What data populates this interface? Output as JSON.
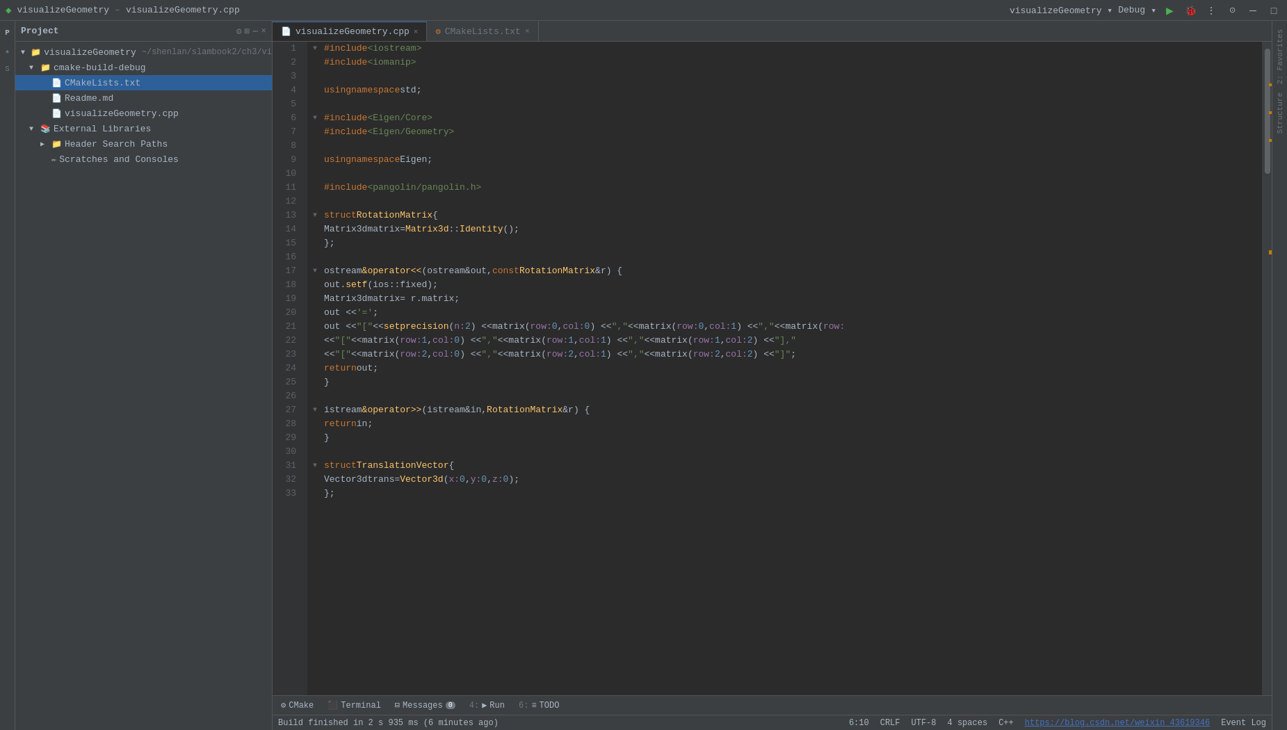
{
  "titlebar": {
    "project_name": "visualizeGeometry",
    "file_name": "visualizeGeometry.cpp",
    "config": "Debug",
    "run_label": "▶",
    "debug_label": "🐞"
  },
  "tabs": [
    {
      "id": "tab-cpp",
      "label": "visualizeGeometry.cpp",
      "icon": "📄",
      "active": true
    },
    {
      "id": "tab-cmake",
      "label": "CMakeLists.txt",
      "icon": "⚙",
      "active": false
    }
  ],
  "project_panel": {
    "title": "Project",
    "tree": [
      {
        "indent": 0,
        "arrow": "▼",
        "icon": "📁",
        "label": "visualizeGeometry",
        "extra": "~/shenlan/slambook2/ch3/vi",
        "selected": false
      },
      {
        "indent": 1,
        "arrow": "▼",
        "icon": "📁",
        "label": "cmake-build-debug",
        "selected": false
      },
      {
        "indent": 2,
        "arrow": "",
        "icon": "📄",
        "label": "CMakeLists.txt",
        "selected": true
      },
      {
        "indent": 2,
        "arrow": "",
        "icon": "📄",
        "label": "Readme.md",
        "selected": false
      },
      {
        "indent": 2,
        "arrow": "",
        "icon": "📄",
        "label": "visualizeGeometry.cpp",
        "selected": false
      },
      {
        "indent": 1,
        "arrow": "▼",
        "icon": "📚",
        "label": "External Libraries",
        "selected": false
      },
      {
        "indent": 2,
        "arrow": "▶",
        "icon": "📁",
        "label": "Header Search Paths",
        "selected": false
      },
      {
        "indent": 2,
        "arrow": "",
        "icon": "✏",
        "label": "Scratches and Consoles",
        "selected": false
      }
    ]
  },
  "code_lines": [
    {
      "num": 1,
      "fold": true,
      "tokens": [
        {
          "t": "#include ",
          "c": "inc"
        },
        {
          "t": "<iostream>",
          "c": "hdr"
        }
      ]
    },
    {
      "num": 2,
      "fold": false,
      "tokens": [
        {
          "t": "#include ",
          "c": "inc"
        },
        {
          "t": "<iomanip>",
          "c": "hdr"
        }
      ]
    },
    {
      "num": 3,
      "fold": false,
      "tokens": []
    },
    {
      "num": 4,
      "fold": false,
      "tokens": [
        {
          "t": "using ",
          "c": "kw"
        },
        {
          "t": "namespace ",
          "c": "kw"
        },
        {
          "t": "std;",
          "c": "plain"
        }
      ]
    },
    {
      "num": 5,
      "fold": false,
      "tokens": []
    },
    {
      "num": 6,
      "fold": true,
      "tokens": [
        {
          "t": "#include ",
          "c": "inc"
        },
        {
          "t": "<Eigen/Core>",
          "c": "hdr"
        }
      ]
    },
    {
      "num": 7,
      "fold": false,
      "tokens": [
        {
          "t": "#include ",
          "c": "inc"
        },
        {
          "t": "<Eigen/Geometry>",
          "c": "hdr"
        }
      ]
    },
    {
      "num": 8,
      "fold": false,
      "tokens": []
    },
    {
      "num": 9,
      "fold": false,
      "tokens": [
        {
          "t": "using ",
          "c": "kw"
        },
        {
          "t": "namespace ",
          "c": "kw"
        },
        {
          "t": "Eigen;",
          "c": "plain"
        }
      ]
    },
    {
      "num": 10,
      "fold": false,
      "tokens": []
    },
    {
      "num": 11,
      "fold": false,
      "tokens": [
        {
          "t": "#include ",
          "c": "inc"
        },
        {
          "t": "<pangolin/pangolin.h>",
          "c": "hdr"
        }
      ]
    },
    {
      "num": 12,
      "fold": false,
      "tokens": []
    },
    {
      "num": 13,
      "fold": true,
      "tokens": [
        {
          "t": "struct ",
          "c": "kw"
        },
        {
          "t": "RotationMatrix ",
          "c": "cls"
        },
        {
          "t": "{",
          "c": "plain"
        }
      ]
    },
    {
      "num": 14,
      "fold": false,
      "tokens": [
        {
          "t": "    Matrix3d ",
          "c": "plain"
        },
        {
          "t": "matrix",
          "c": "plain"
        },
        {
          "t": " = ",
          "c": "plain"
        },
        {
          "t": "Matrix3d",
          "c": "cls"
        },
        {
          "t": "::",
          "c": "plain"
        },
        {
          "t": "Identity",
          "c": "fn"
        },
        {
          "t": "();",
          "c": "plain"
        }
      ]
    },
    {
      "num": 15,
      "fold": false,
      "tokens": [
        {
          "t": "};",
          "c": "plain"
        }
      ]
    },
    {
      "num": 16,
      "fold": false,
      "tokens": []
    },
    {
      "num": 17,
      "fold": true,
      "tokens": [
        {
          "t": "ostream ",
          "c": "plain"
        },
        {
          "t": "&operator<<",
          "c": "fn"
        },
        {
          "t": "(",
          "c": "plain"
        },
        {
          "t": "ostream ",
          "c": "plain"
        },
        {
          "t": "&out, ",
          "c": "plain"
        },
        {
          "t": "const ",
          "c": "kw"
        },
        {
          "t": "RotationMatrix ",
          "c": "cls"
        },
        {
          "t": "&r) {",
          "c": "plain"
        }
      ]
    },
    {
      "num": 18,
      "fold": false,
      "tokens": [
        {
          "t": "    out.",
          "c": "plain"
        },
        {
          "t": "setf",
          "c": "fn"
        },
        {
          "t": "(",
          "c": "plain"
        },
        {
          "t": "ios::fixed",
          "c": "plain"
        },
        {
          "t": ");",
          "c": "plain"
        }
      ]
    },
    {
      "num": 19,
      "fold": false,
      "tokens": [
        {
          "t": "    Matrix3d ",
          "c": "plain"
        },
        {
          "t": "matrix",
          "c": "plain"
        },
        {
          "t": " = r.",
          "c": "plain"
        },
        {
          "t": "matrix",
          "c": "plain"
        },
        {
          "t": ";",
          "c": "plain"
        }
      ]
    },
    {
      "num": 20,
      "fold": false,
      "tokens": [
        {
          "t": "    out << ",
          "c": "plain"
        },
        {
          "t": "'='",
          "c": "str"
        },
        {
          "t": ";",
          "c": "plain"
        }
      ]
    },
    {
      "num": 21,
      "fold": false,
      "tokens": [
        {
          "t": "    out << ",
          "c": "plain"
        },
        {
          "t": "\"[\"",
          "c": "str"
        },
        {
          "t": " << ",
          "c": "plain"
        },
        {
          "t": "setprecision",
          "c": "fn"
        },
        {
          "t": "( ",
          "c": "plain"
        },
        {
          "t": "n: ",
          "c": "var"
        },
        {
          "t": "2",
          "c": "num"
        },
        {
          "t": ") << ",
          "c": "plain"
        },
        {
          "t": "matrix",
          "c": "plain"
        },
        {
          "t": "( ",
          "c": "plain"
        },
        {
          "t": "row: ",
          "c": "var"
        },
        {
          "t": "0",
          "c": "num"
        },
        {
          "t": ", ",
          "c": "plain"
        },
        {
          "t": "col: ",
          "c": "var"
        },
        {
          "t": "0",
          "c": "num"
        },
        {
          "t": ") << ",
          "c": "plain"
        },
        {
          "t": "\",\"",
          "c": "str"
        },
        {
          "t": " << ",
          "c": "plain"
        },
        {
          "t": "matrix",
          "c": "plain"
        },
        {
          "t": "( ",
          "c": "plain"
        },
        {
          "t": "row: ",
          "c": "var"
        },
        {
          "t": "0",
          "c": "num"
        },
        {
          "t": ", ",
          "c": "plain"
        },
        {
          "t": "col: ",
          "c": "var"
        },
        {
          "t": "1",
          "c": "num"
        },
        {
          "t": ") << ",
          "c": "plain"
        },
        {
          "t": "\",\"",
          "c": "str"
        },
        {
          "t": " << ",
          "c": "plain"
        },
        {
          "t": "matrix",
          "c": "plain"
        },
        {
          "t": "( ",
          "c": "plain"
        },
        {
          "t": "row:",
          "c": "var"
        }
      ]
    },
    {
      "num": 22,
      "fold": false,
      "tokens": [
        {
          "t": "        << ",
          "c": "plain"
        },
        {
          "t": "\"[\"",
          "c": "str"
        },
        {
          "t": " << ",
          "c": "plain"
        },
        {
          "t": "matrix",
          "c": "plain"
        },
        {
          "t": "( ",
          "c": "plain"
        },
        {
          "t": "row: ",
          "c": "var"
        },
        {
          "t": "1",
          "c": "num"
        },
        {
          "t": ", ",
          "c": "plain"
        },
        {
          "t": "col: ",
          "c": "var"
        },
        {
          "t": "0",
          "c": "num"
        },
        {
          "t": ") << ",
          "c": "plain"
        },
        {
          "t": "\",\"",
          "c": "str"
        },
        {
          "t": " << ",
          "c": "plain"
        },
        {
          "t": "matrix",
          "c": "plain"
        },
        {
          "t": "( ",
          "c": "plain"
        },
        {
          "t": "row: ",
          "c": "var"
        },
        {
          "t": "1",
          "c": "num"
        },
        {
          "t": ", ",
          "c": "plain"
        },
        {
          "t": "col: ",
          "c": "var"
        },
        {
          "t": "1",
          "c": "num"
        },
        {
          "t": ") << ",
          "c": "plain"
        },
        {
          "t": "\",\"",
          "c": "str"
        },
        {
          "t": " << ",
          "c": "plain"
        },
        {
          "t": "matrix",
          "c": "plain"
        },
        {
          "t": "( ",
          "c": "plain"
        },
        {
          "t": "row: ",
          "c": "var"
        },
        {
          "t": "1",
          "c": "num"
        },
        {
          "t": ", ",
          "c": "plain"
        },
        {
          "t": "col: ",
          "c": "var"
        },
        {
          "t": "2",
          "c": "num"
        },
        {
          "t": ") << ",
          "c": "plain"
        },
        {
          "t": "\"],\"",
          "c": "str"
        }
      ]
    },
    {
      "num": 23,
      "fold": false,
      "tokens": [
        {
          "t": "        << ",
          "c": "plain"
        },
        {
          "t": "\"[\"",
          "c": "str"
        },
        {
          "t": " << ",
          "c": "plain"
        },
        {
          "t": "matrix",
          "c": "plain"
        },
        {
          "t": "( ",
          "c": "plain"
        },
        {
          "t": "row: ",
          "c": "var"
        },
        {
          "t": "2",
          "c": "num"
        },
        {
          "t": ", ",
          "c": "plain"
        },
        {
          "t": "col: ",
          "c": "var"
        },
        {
          "t": "0",
          "c": "num"
        },
        {
          "t": ") << ",
          "c": "plain"
        },
        {
          "t": "\",\"",
          "c": "str"
        },
        {
          "t": " << ",
          "c": "plain"
        },
        {
          "t": "matrix",
          "c": "plain"
        },
        {
          "t": "( ",
          "c": "plain"
        },
        {
          "t": "row: ",
          "c": "var"
        },
        {
          "t": "2",
          "c": "num"
        },
        {
          "t": ", ",
          "c": "plain"
        },
        {
          "t": "col: ",
          "c": "var"
        },
        {
          "t": "1",
          "c": "num"
        },
        {
          "t": ") << ",
          "c": "plain"
        },
        {
          "t": "\",\"",
          "c": "str"
        },
        {
          "t": " << ",
          "c": "plain"
        },
        {
          "t": "matrix",
          "c": "plain"
        },
        {
          "t": "( ",
          "c": "plain"
        },
        {
          "t": "row: ",
          "c": "var"
        },
        {
          "t": "2",
          "c": "num"
        },
        {
          "t": ", ",
          "c": "plain"
        },
        {
          "t": "col: ",
          "c": "var"
        },
        {
          "t": "2",
          "c": "num"
        },
        {
          "t": ") << ",
          "c": "plain"
        },
        {
          "t": "\"]\"",
          "c": "str"
        },
        {
          "t": ";",
          "c": "plain"
        }
      ]
    },
    {
      "num": 24,
      "fold": false,
      "tokens": [
        {
          "t": "    return ",
          "c": "kw"
        },
        {
          "t": "out;",
          "c": "plain"
        }
      ]
    },
    {
      "num": 25,
      "fold": false,
      "tokens": [
        {
          "t": "}",
          "c": "plain"
        }
      ]
    },
    {
      "num": 26,
      "fold": false,
      "tokens": []
    },
    {
      "num": 27,
      "fold": true,
      "tokens": [
        {
          "t": "istream ",
          "c": "plain"
        },
        {
          "t": "&operator>>",
          "c": "fn"
        },
        {
          "t": "(",
          "c": "plain"
        },
        {
          "t": "istream ",
          "c": "plain"
        },
        {
          "t": "&in, ",
          "c": "plain"
        },
        {
          "t": "RotationMatrix ",
          "c": "cls"
        },
        {
          "t": "&r) {",
          "c": "plain"
        }
      ]
    },
    {
      "num": 28,
      "fold": false,
      "tokens": [
        {
          "t": "    return ",
          "c": "kw"
        },
        {
          "t": "in;",
          "c": "plain"
        }
      ]
    },
    {
      "num": 29,
      "fold": false,
      "tokens": [
        {
          "t": "}",
          "c": "plain"
        }
      ]
    },
    {
      "num": 30,
      "fold": false,
      "tokens": []
    },
    {
      "num": 31,
      "fold": true,
      "tokens": [
        {
          "t": "struct ",
          "c": "kw"
        },
        {
          "t": "TranslationVector ",
          "c": "cls"
        },
        {
          "t": "{",
          "c": "plain"
        }
      ]
    },
    {
      "num": 32,
      "fold": false,
      "tokens": [
        {
          "t": "    Vector3d ",
          "c": "plain"
        },
        {
          "t": "trans",
          "c": "plain"
        },
        {
          "t": " = ",
          "c": "plain"
        },
        {
          "t": "Vector3d",
          "c": "cls"
        },
        {
          "t": "( ",
          "c": "plain"
        },
        {
          "t": "x: ",
          "c": "var"
        },
        {
          "t": "0",
          "c": "num"
        },
        {
          "t": ", ",
          "c": "plain"
        },
        {
          "t": "y: ",
          "c": "var"
        },
        {
          "t": "0",
          "c": "num"
        },
        {
          "t": ", ",
          "c": "plain"
        },
        {
          "t": "z: ",
          "c": "var"
        },
        {
          "t": "0",
          "c": "num"
        },
        {
          "t": ");",
          "c": "plain"
        }
      ]
    },
    {
      "num": 33,
      "fold": false,
      "tokens": [
        {
          "t": "};",
          "c": "plain"
        }
      ]
    }
  ],
  "bottom_tabs": [
    {
      "icon": "⚙",
      "label": "CMake",
      "shortcut": ""
    },
    {
      "icon": "⬛",
      "label": "Terminal",
      "shortcut": ""
    },
    {
      "icon": "⊟",
      "label": "Messages",
      "badge": "0",
      "shortcut": ""
    },
    {
      "icon": "▶",
      "label": "Run",
      "shortcut": "4"
    },
    {
      "icon": "≡",
      "label": "TODO",
      "shortcut": "6"
    }
  ],
  "build_message": "Build finished in 2 s 935 ms (6 minutes ago)",
  "status": {
    "cursor": "6:10",
    "crlf": "CRLF",
    "encoding": "UTF-8",
    "spaces": "4 spaces",
    "language": "C++",
    "url": "https://blog.csdn.net/weixin_43619346",
    "event_log": "Event Log"
  }
}
